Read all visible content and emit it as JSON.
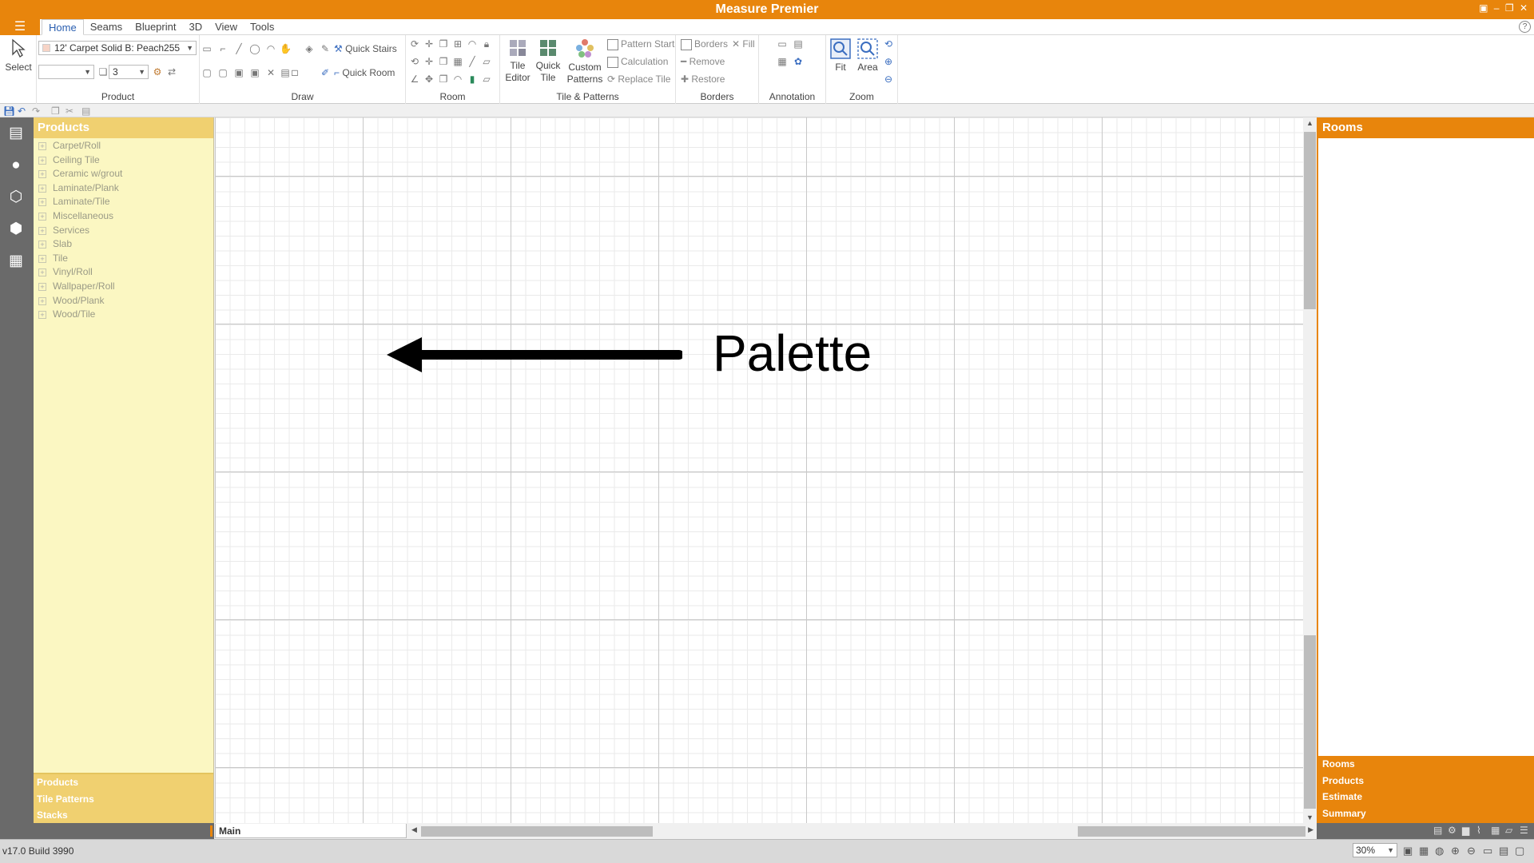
{
  "app": {
    "title": "Measure Premier"
  },
  "menu": {
    "tabs": [
      "Home",
      "Seams",
      "Blueprint",
      "3D",
      "View",
      "Tools"
    ],
    "active": "Home"
  },
  "ribbon": {
    "select_label": "Select",
    "product": {
      "group_label": "Product",
      "product_combo": "12' Carpet Solid B: Peach255",
      "variant_combo": "",
      "qty_combo": "3"
    },
    "draw": {
      "group_label": "Draw",
      "quick_stairs": "Quick Stairs",
      "quick_room": "Quick Room"
    },
    "room": {
      "group_label": "Room"
    },
    "tiles": {
      "group_label": "Tile & Patterns",
      "tile_editor": "Tile Editor",
      "quick_tile": "Quick Tile",
      "custom_patterns": "Custom Patterns",
      "pattern_start": "Pattern Start",
      "calculation": "Calculation",
      "replace_tile": "Replace Tile"
    },
    "borders": {
      "group_label": "Borders",
      "borders": "Borders",
      "fill": "Fill",
      "remove": "Remove",
      "restore": "Restore"
    },
    "annotation": {
      "group_label": "Annotation"
    },
    "zoom": {
      "group_label": "Zoom",
      "fit": "Fit",
      "area": "Area"
    }
  },
  "palette": {
    "header": "Products",
    "items": [
      "Carpet/Roll",
      "Ceiling Tile",
      "Ceramic w/grout",
      "Laminate/Plank",
      "Laminate/Tile",
      "Miscellaneous",
      "Services",
      "Slab",
      "Tile",
      "Vinyl/Roll",
      "Wallpaper/Roll",
      "Wood/Plank",
      "Wood/Tile"
    ],
    "footer_tabs": [
      "Products",
      "Tile Patterns",
      "Stacks"
    ]
  },
  "canvas": {
    "annotation_label": "Palette",
    "sheet_tab": "Main"
  },
  "rooms_panel": {
    "header": "Rooms",
    "footer_tabs": [
      "Rooms",
      "Products",
      "Estimate",
      "Summary"
    ]
  },
  "status": {
    "version": "v17.0 Build 3990",
    "zoom": "30%"
  },
  "colors": {
    "accent": "#e8850c",
    "palette_bg": "#fbf7c2",
    "palette_header": "#f0d070"
  }
}
